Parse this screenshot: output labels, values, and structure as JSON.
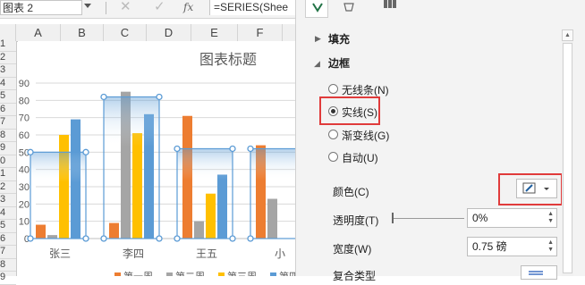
{
  "formula_bar": {
    "name_box": "图表 2",
    "cancel_icon": "✕",
    "enter_icon": "✓",
    "fx": "fx",
    "formula": "=SERIES(Shee"
  },
  "columns": [
    "A",
    "B",
    "C",
    "D",
    "E",
    "F"
  ],
  "rows": [
    "1",
    "2",
    "3",
    "4",
    "5",
    "6",
    "7",
    "8",
    "9",
    "0",
    "1",
    "2",
    "3",
    "4",
    "5",
    "6",
    "7",
    "8",
    "9"
  ],
  "chart_data": {
    "type": "bar",
    "title": "图表标题",
    "categories": [
      "张三",
      "李四",
      "王五",
      "小"
    ],
    "ylim": [
      0,
      90
    ],
    "yticks": [
      0,
      10,
      20,
      30,
      40,
      50,
      60,
      70,
      80,
      90
    ],
    "series": [
      {
        "name": "第一周",
        "color": "#ed7d31",
        "values": [
          8,
          9,
          71,
          54
        ]
      },
      {
        "name": "第二周",
        "color": "#a5a5a5",
        "values": [
          2,
          85,
          10,
          23
        ]
      },
      {
        "name": "第三周",
        "color": "#ffc000",
        "values": [
          60,
          61,
          26,
          null
        ]
      },
      {
        "name": "第四周",
        "color": "#5b9bd5",
        "values": [
          69,
          72,
          37,
          null
        ]
      }
    ],
    "highlight_bars": [
      50,
      82,
      52,
      52
    ],
    "legend_position": "bottom",
    "grid": true
  },
  "panel": {
    "fill_label": "填充",
    "border_label": "边框",
    "options": [
      "无线条(N)",
      "实线(S)",
      "渐变线(G)",
      "自动(U)"
    ],
    "selected_option": "实线(S)",
    "color_label": "颜色(C)",
    "transparency_label": "透明度(T)",
    "transparency_value": "0%",
    "width_label": "宽度(W)",
    "width_value": "0.75 磅",
    "compound_label": "复合类型"
  },
  "colors": {
    "highlight": "#e03b3b",
    "selection": "#5b9bd5"
  }
}
